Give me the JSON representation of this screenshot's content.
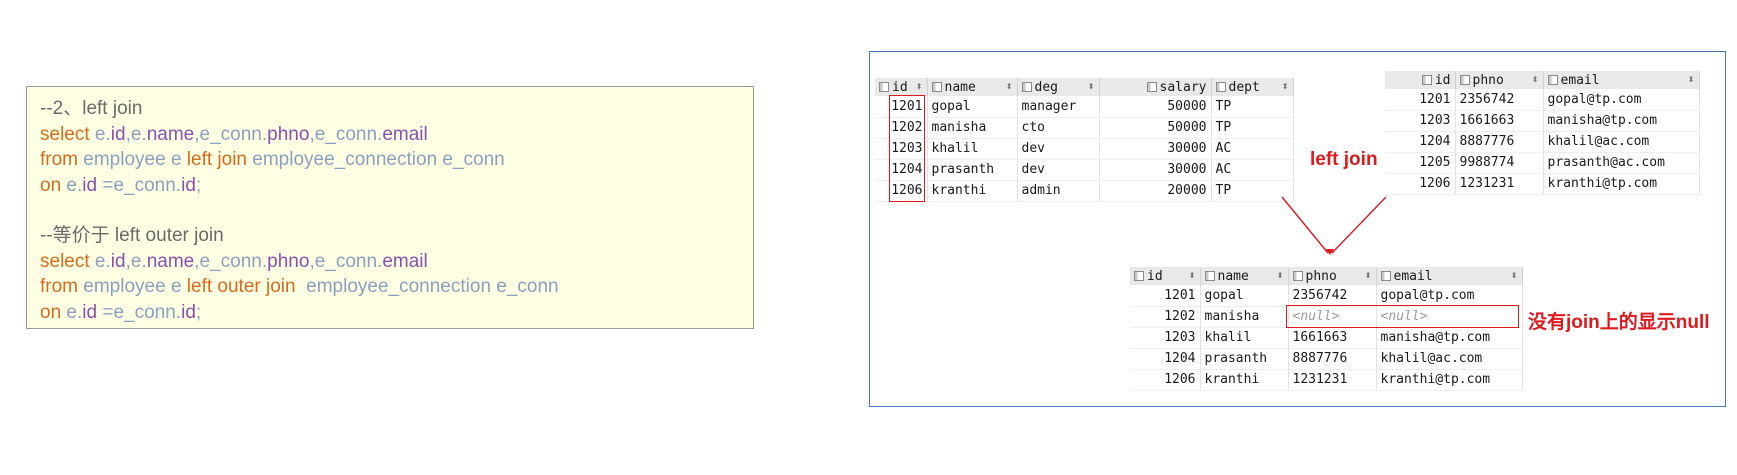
{
  "sql": {
    "block1": {
      "comment": "--2、left join",
      "select_kw": "select",
      "select_fields": [
        {
          "alias": "e.",
          "field": "id"
        },
        {
          "alias": "e.",
          "field": "name"
        },
        {
          "alias": "e_conn.",
          "field": "phno"
        },
        {
          "alias": "e_conn.",
          "field": "email"
        }
      ],
      "from_kw": "from",
      "table1": "employee e",
      "join_kw": "left join",
      "table2": "employee_connection e_conn",
      "on_kw": "on",
      "cond_left_alias": "e.",
      "cond_left_field": "id",
      "cond_op": "=",
      "cond_right_alias": "e_conn.",
      "cond_right_field": "id",
      "terminator": ";"
    },
    "block2": {
      "comment": "--等价于 left outer join",
      "select_kw": "select",
      "from_kw": "from",
      "table1": "employee e",
      "join_kw": "left outer join",
      "table2": "employee_connection e_conn",
      "on_kw": "on"
    }
  },
  "employee_table": {
    "columns": [
      "id",
      "name",
      "deg",
      "salary",
      "dept"
    ],
    "rows": [
      [
        "1201",
        "gopal",
        "manager",
        "50000",
        "TP"
      ],
      [
        "1202",
        "manisha",
        "cto",
        "50000",
        "TP"
      ],
      [
        "1203",
        "khalil",
        "dev",
        "30000",
        "AC"
      ],
      [
        "1204",
        "prasanth",
        "dev",
        "30000",
        "AC"
      ],
      [
        "1206",
        "kranthi",
        "admin",
        "20000",
        "TP"
      ]
    ]
  },
  "connection_table": {
    "columns": [
      "id",
      "phno",
      "email"
    ],
    "rows": [
      [
        "1201",
        "2356742",
        "gopal@tp.com"
      ],
      [
        "1203",
        "1661663",
        "manisha@tp.com"
      ],
      [
        "1204",
        "8887776",
        "khalil@ac.com"
      ],
      [
        "1205",
        "9988774",
        "prasanth@ac.com"
      ],
      [
        "1206",
        "1231231",
        "kranthi@tp.com"
      ]
    ]
  },
  "result_table": {
    "columns": [
      "id",
      "name",
      "phno",
      "email"
    ],
    "rows": [
      [
        "1201",
        "gopal",
        "2356742",
        "gopal@tp.com"
      ],
      [
        "1202",
        "manisha",
        "<null>",
        "<null>"
      ],
      [
        "1203",
        "khalil",
        "1661663",
        "manisha@tp.com"
      ],
      [
        "1204",
        "prasanth",
        "8887776",
        "khalil@ac.com"
      ],
      [
        "1206",
        "kranthi",
        "1231231",
        "kranthi@tp.com"
      ]
    ]
  },
  "annotations": {
    "left_join_label": "left join",
    "null_note": "没有join上的显示null",
    "highlight_color": "#e0191e"
  }
}
